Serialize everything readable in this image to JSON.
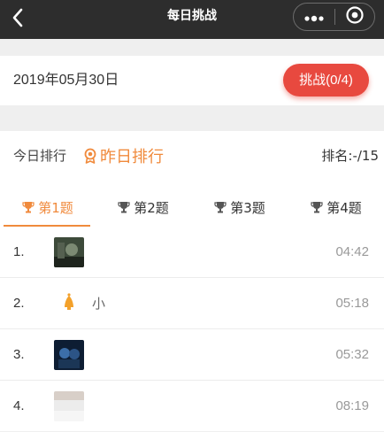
{
  "header": {
    "title": "每日挑战"
  },
  "date_bar": {
    "date": "2019年05月30日",
    "challenge_label": "挑战(0/4)"
  },
  "ranking": {
    "today_label": "今日排行",
    "yesterday_label": "昨日排行",
    "rank_label": "排名:-/15",
    "tabs": [
      {
        "label": "第1题"
      },
      {
        "label": "第2题"
      },
      {
        "label": "第3题"
      },
      {
        "label": "第4题"
      }
    ],
    "rows": [
      {
        "rank": "1.",
        "name": "",
        "time": "04:42"
      },
      {
        "rank": "2.",
        "name": "小",
        "time": "05:18"
      },
      {
        "rank": "3.",
        "name": "",
        "time": "05:32"
      },
      {
        "rank": "4.",
        "name": "",
        "time": "08:19"
      }
    ]
  },
  "colors": {
    "accent": "#f08a3c",
    "button": "#e8493f",
    "topbar": "#2d2d2d"
  }
}
